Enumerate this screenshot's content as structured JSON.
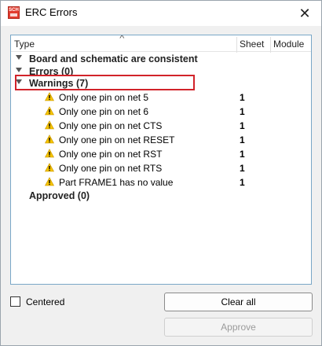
{
  "window": {
    "title": "ERC Errors",
    "app_icon": "sch-icon",
    "close_glyph": "✕"
  },
  "table": {
    "columns": [
      "Type",
      "Sheet",
      "Module"
    ],
    "sort_glyph": "^",
    "groups": {
      "consistent": "Board and schematic are consistent",
      "errors": "Errors (0)",
      "warnings": "Warnings (7)",
      "approved": "Approved (0)"
    },
    "warnings": [
      {
        "label": "Only one pin on net 5",
        "sheet": "1"
      },
      {
        "label": "Only one pin on net 6",
        "sheet": "1"
      },
      {
        "label": "Only one pin on net CTS",
        "sheet": "1"
      },
      {
        "label": "Only one pin on net RESET",
        "sheet": "1"
      },
      {
        "label": "Only one pin on net RST",
        "sheet": "1"
      },
      {
        "label": "Only one pin on net RTS",
        "sheet": "1"
      },
      {
        "label": "Part FRAME1 has no value",
        "sheet": "1"
      }
    ]
  },
  "footer": {
    "centered_label": "Centered",
    "centered_checked": false,
    "clear_all_label": "Clear all",
    "approve_label": "Approve"
  },
  "colors": {
    "highlight": "#d2232a",
    "warning_icon": "#f5c400",
    "panel_border": "#7aa7c7"
  }
}
